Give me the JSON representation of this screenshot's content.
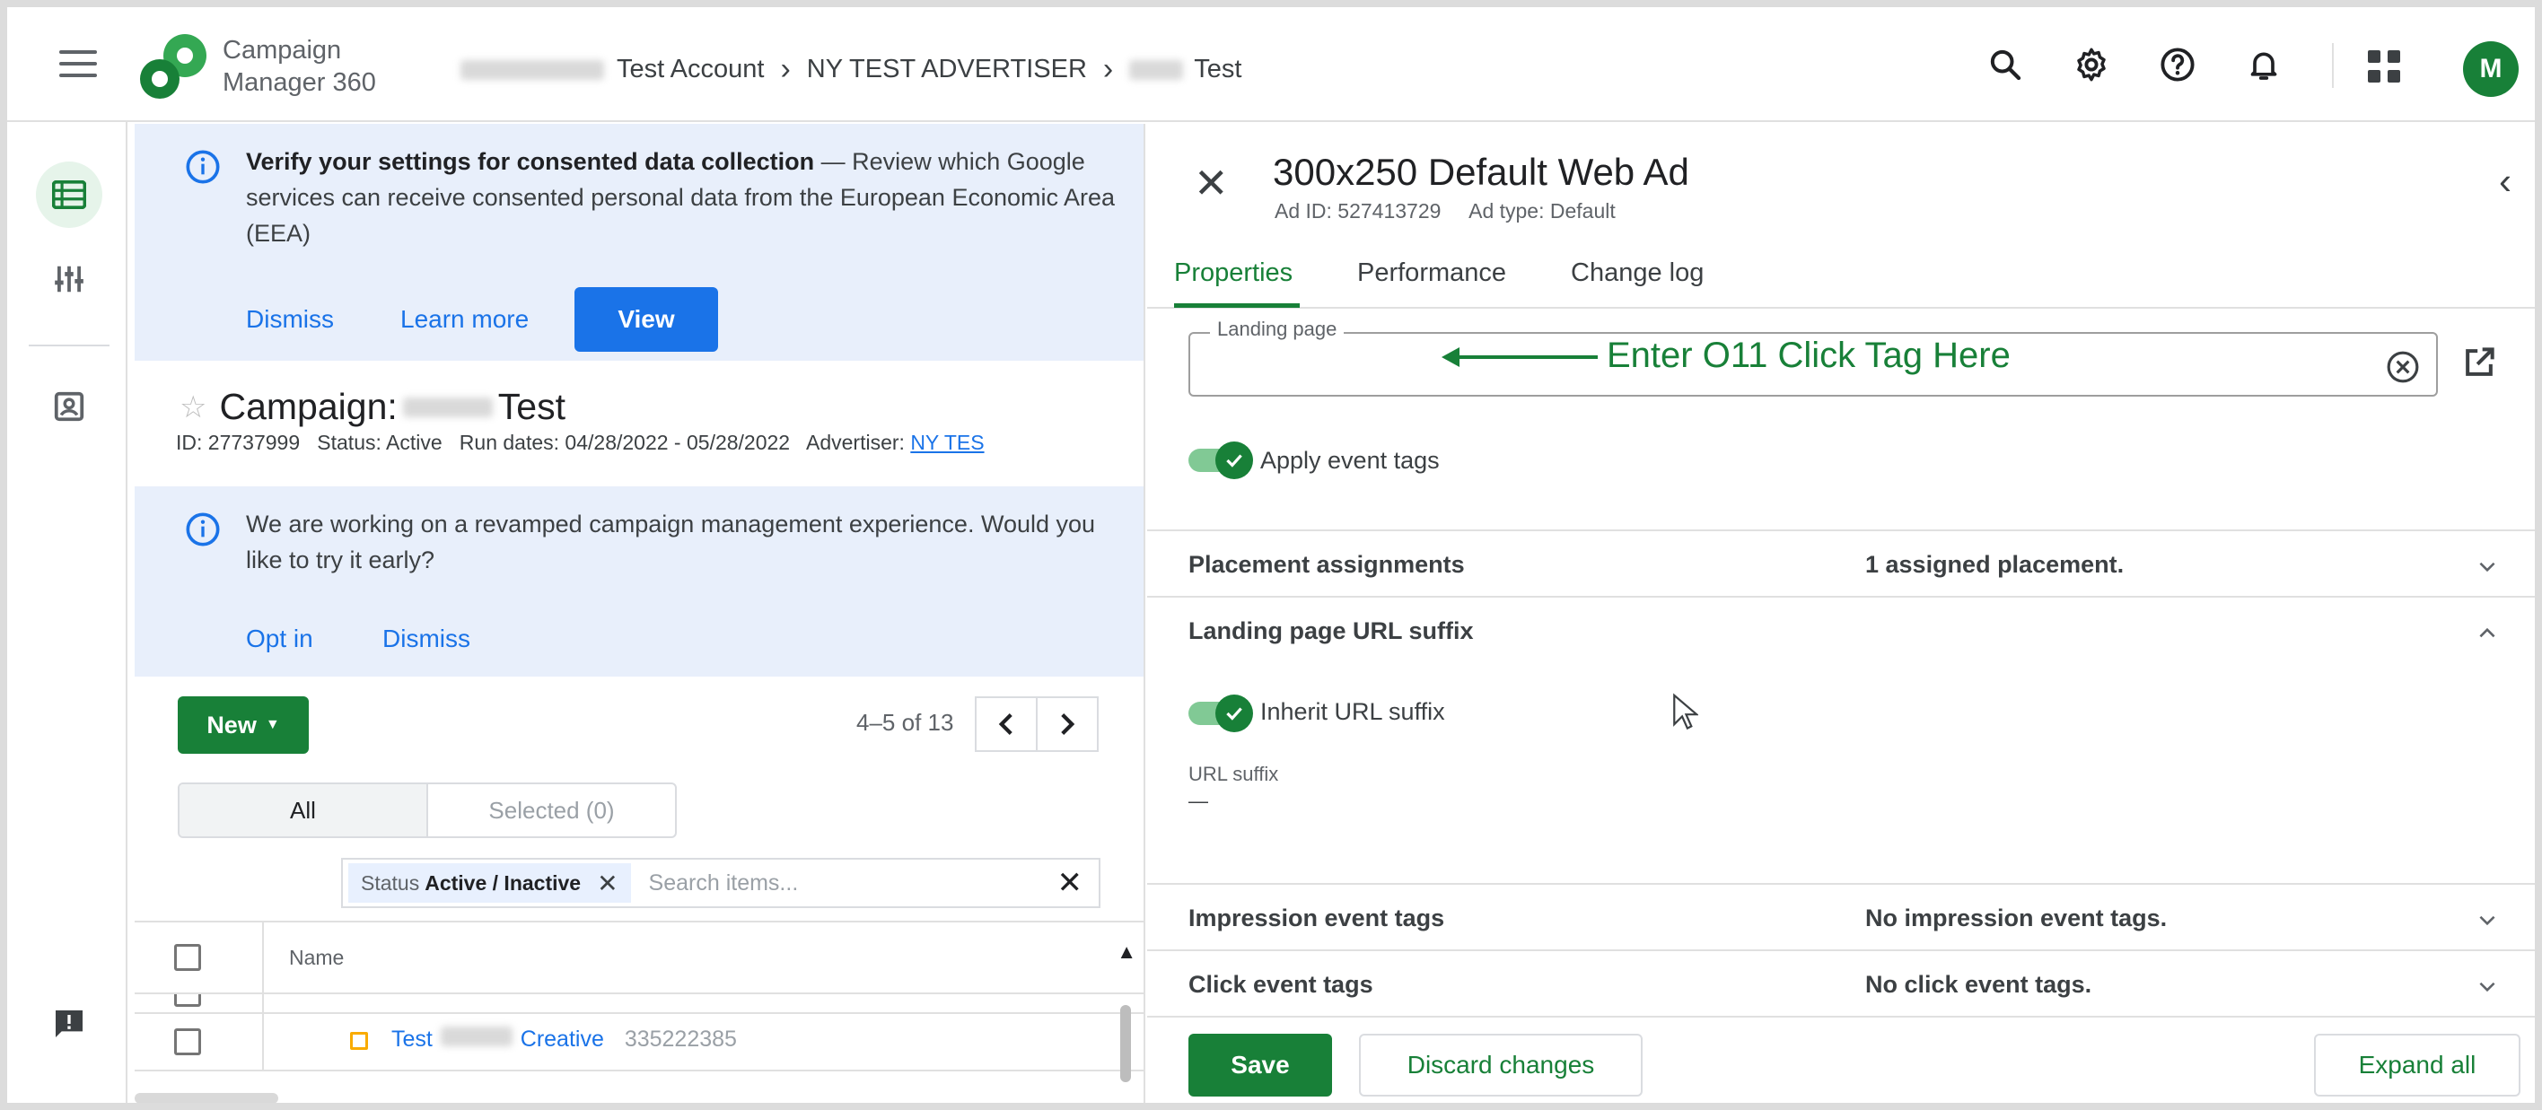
{
  "app": {
    "brand_line1": "Campaign",
    "brand_line2": "Manager 360",
    "brand_color": "#188038",
    "accent_blue": "#1a73e8"
  },
  "breadcrumbs": {
    "account": "Test Account",
    "advertiser": "NY TEST ADVERTISER",
    "campaign": "Test"
  },
  "topbar": {
    "icons": [
      "search-icon",
      "gear-icon",
      "help-icon",
      "bell-icon",
      "apps-icon"
    ],
    "avatar_letter": "M"
  },
  "consent_banner": {
    "title": "Verify your settings for consented data collection",
    "body": " — Review which Google services can receive consented personal data from the European Economic Area (EEA)",
    "dismiss": "Dismiss",
    "learn_more": "Learn more",
    "view": "View"
  },
  "campaign": {
    "title_prefix": "Campaign:",
    "title_suffix": "Test",
    "meta": "ID: 27737999   Status: Active   Run dates: 04/28/2022 - 05/28/2022   Advertiser: ",
    "advertiser_link": "NY TES"
  },
  "revamp_banner": {
    "body": "We are working on a revamped campaign management experience. Would you like to try it early?",
    "opt_in": "Opt in",
    "dismiss": "Dismiss"
  },
  "list": {
    "new_button": "New",
    "page_count": "4–5 of 13",
    "seg_all": "All",
    "seg_selected": "Selected (0)",
    "filter_label": "Status",
    "filter_value": "Active / Inactive",
    "search_placeholder": "Search items...",
    "col_name": "Name",
    "rows": [
      {
        "name": "Test",
        "name_suffix": "Creative",
        "id": "335222385"
      }
    ]
  },
  "panel": {
    "ad_title": "300x250 Default Web Ad",
    "ad_meta": "Ad ID: 527413729     Ad type: Default",
    "tabs": [
      "Properties",
      "Performance",
      "Change log"
    ],
    "landing_page_label": "Landing page",
    "landing_page_value": "",
    "annotation": "Enter O11 Click Tag Here",
    "apply_event_tags": "Apply event tags",
    "sections": {
      "placement_title": "Placement assignments",
      "placement_value": "1 assigned placement.",
      "lp_suffix_title": "Landing page URL suffix",
      "inherit_url_suffix": "Inherit URL suffix",
      "url_suffix_label": "URL suffix",
      "url_suffix_value": "—",
      "impression_title": "Impression event tags",
      "impression_value": "No impression event tags.",
      "click_title": "Click event tags",
      "click_value": "No click event tags."
    },
    "save": "Save",
    "discard": "Discard changes",
    "expand_all": "Expand all"
  }
}
